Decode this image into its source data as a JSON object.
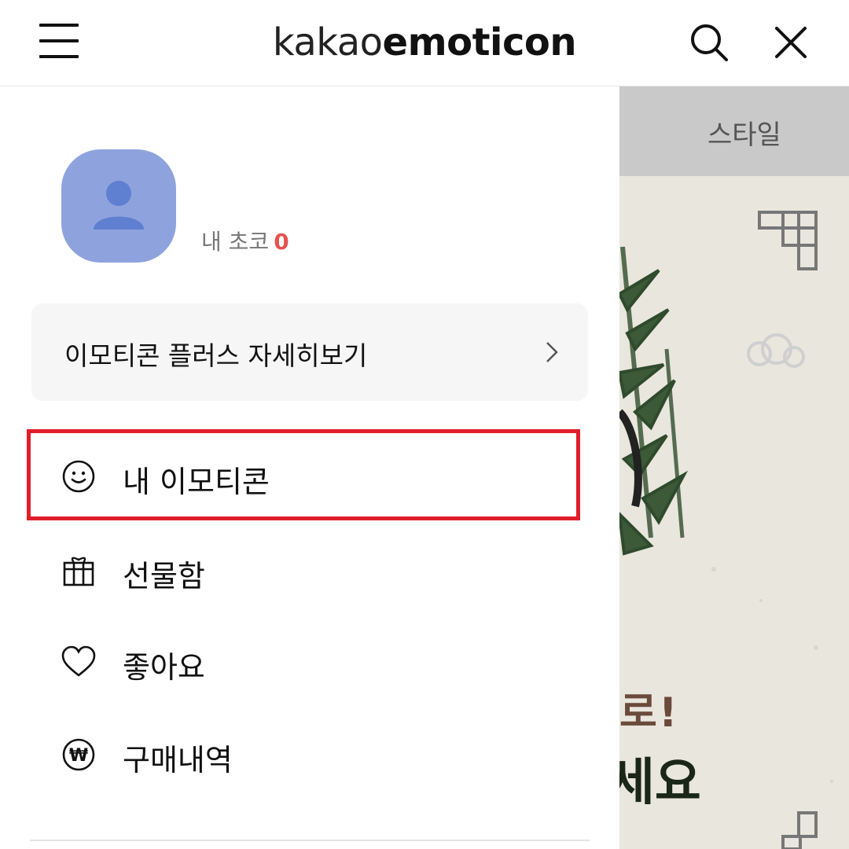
{
  "header": {
    "logo_light": "kakao",
    "logo_bold": "emoticon",
    "icons": [
      "hamburger-menu-icon",
      "search-icon",
      "close-icon"
    ]
  },
  "drawer": {
    "profile": {
      "avatar_icon": "person-icon",
      "choco_label": "내 초코",
      "choco_count": "0"
    },
    "plus_banner": {
      "label": "이모티콘 플러스 자세히보기",
      "icon": "chevron-right-icon"
    },
    "menu": [
      {
        "label": "내 이모티콘",
        "icon": "smile-face-icon"
      },
      {
        "label": "선물함",
        "icon": "gift-icon"
      },
      {
        "label": "좋아요",
        "icon": "heart-icon"
      },
      {
        "label": "구매내역",
        "icon": "won-icon"
      }
    ]
  },
  "background_page": {
    "tab_label": "스타일",
    "banner_text_1": "로!",
    "banner_text_2": "세요"
  },
  "colors": {
    "avatar": "#8ea3de",
    "choco_count": "#e4534f",
    "highlight_border": "#e01e2a",
    "plus_box_bg": "#f6f6f6"
  }
}
